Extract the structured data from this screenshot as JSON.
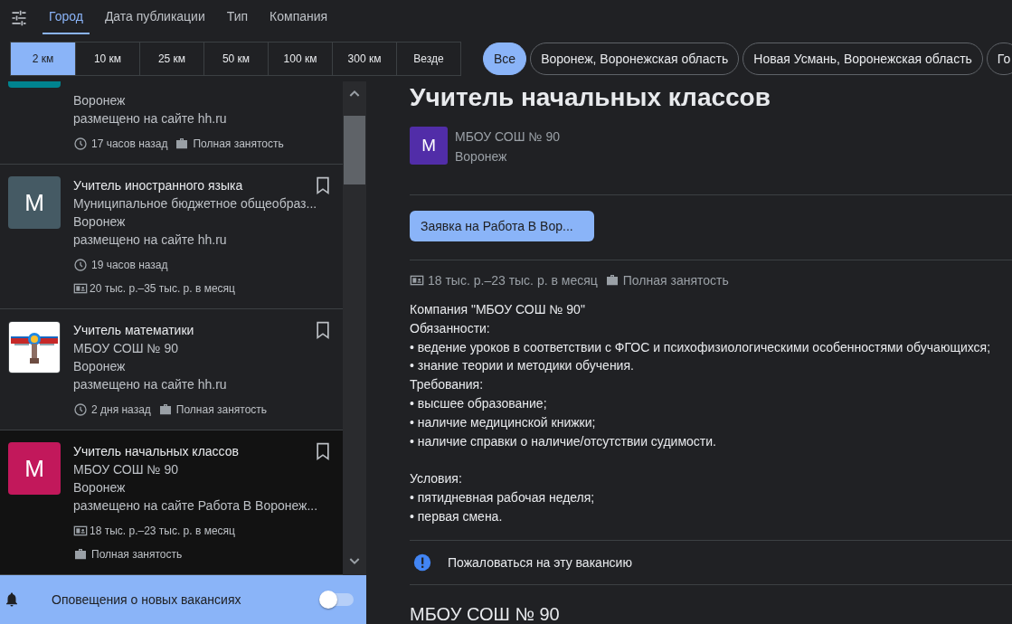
{
  "tabs": [
    {
      "label": "Город",
      "selected": true
    },
    {
      "label": "Дата публикации",
      "selected": false
    },
    {
      "label": "Тип",
      "selected": false
    },
    {
      "label": "Компания",
      "selected": false
    }
  ],
  "distances": [
    {
      "label": "2 км",
      "selected": true
    },
    {
      "label": "10 км",
      "selected": false
    },
    {
      "label": "25 км",
      "selected": false
    },
    {
      "label": "50 км",
      "selected": false
    },
    {
      "label": "100 км",
      "selected": false
    },
    {
      "label": "300 км",
      "selected": false
    },
    {
      "label": "Везде",
      "selected": false
    }
  ],
  "locations": [
    {
      "label": "Все",
      "selected": true
    },
    {
      "label": "Воронеж, Воронежская область",
      "selected": false
    },
    {
      "label": "Новая Усмань, Воронежская область",
      "selected": false
    },
    {
      "label": "Го",
      "selected": false
    }
  ],
  "vacancies": [
    {
      "avatar": {
        "kind": "cut",
        "color": "#00838f"
      },
      "city": "Воронеж",
      "source": "размещено на сайте hh.ru",
      "selected": false,
      "meta": [
        {
          "kind": "posted",
          "text": "17 часов назад"
        },
        {
          "kind": "employment",
          "text": "Полная занятость"
        }
      ]
    },
    {
      "title": "Учитель иностранного языка",
      "company": "Муниципальное бюджетное общеобраз...",
      "avatar": {
        "kind": "letter",
        "letter": "М",
        "color": "#455a64"
      },
      "city": "Воронеж",
      "source": "размещено на сайте hh.ru",
      "selected": false,
      "meta": [
        {
          "kind": "posted",
          "text": "19 часов назад"
        },
        {
          "kind": "salary",
          "text": "20 тыс. р.–35 тыс. р. в месяц"
        }
      ]
    },
    {
      "title": "Учитель математики",
      "company": "МБОУ СОШ № 90",
      "avatar": {
        "kind": "picture"
      },
      "city": "Воронеж",
      "source": "размещено на сайте hh.ru",
      "selected": false,
      "meta": [
        {
          "kind": "posted",
          "text": "2 дня назад"
        },
        {
          "kind": "employment",
          "text": "Полная занятость"
        }
      ]
    },
    {
      "title": "Учитель начальных классов",
      "company": "МБОУ СОШ № 90",
      "avatar": {
        "kind": "letter",
        "letter": "М",
        "color": "#c2185b"
      },
      "city": "Воронеж",
      "source": "размещено на сайте Работа В Воронеж...",
      "selected": true,
      "meta": [
        {
          "kind": "salary",
          "text": "18 тыс. р.–23 тыс. р. в месяц"
        },
        {
          "kind": "employment",
          "text": "Полная занятость"
        }
      ]
    }
  ],
  "notifications": {
    "label": "Оповещения о новых вакансиях",
    "on": false
  },
  "detail": {
    "title": "Учитель начальных классов",
    "company": "МБОУ СОШ № 90",
    "city": "Воронеж",
    "avatar": {
      "kind": "letter",
      "letter": "М",
      "color": "#512da8"
    },
    "apply_button": "Заявка на Работа В Вор...",
    "meta": [
      {
        "kind": "salary",
        "text": "18 тыс. р.–23 тыс. р. в месяц"
      },
      {
        "kind": "employment",
        "text": "Полная занятость"
      }
    ],
    "description": [
      {
        "lines": [
          "Компания \"МБОУ СОШ № 90\"",
          "Обязанности:",
          "• ведение уроков в соответствии с ФГОС и психофизиологическими особенностями обучающихся;",
          "• знание теории и методики обучения.",
          "Требования:",
          "• высшее образование;",
          "• наличие медицинской книжки;",
          "• наличие справки о наличие/отсутствии судимости."
        ]
      },
      {
        "lines": [
          "Условия:",
          "• пятидневная рабочая неделя;",
          "• первая смена."
        ]
      }
    ],
    "report_link": "Пожаловаться на эту вакансию",
    "company_heading": "МБОУ СОШ № 90"
  }
}
